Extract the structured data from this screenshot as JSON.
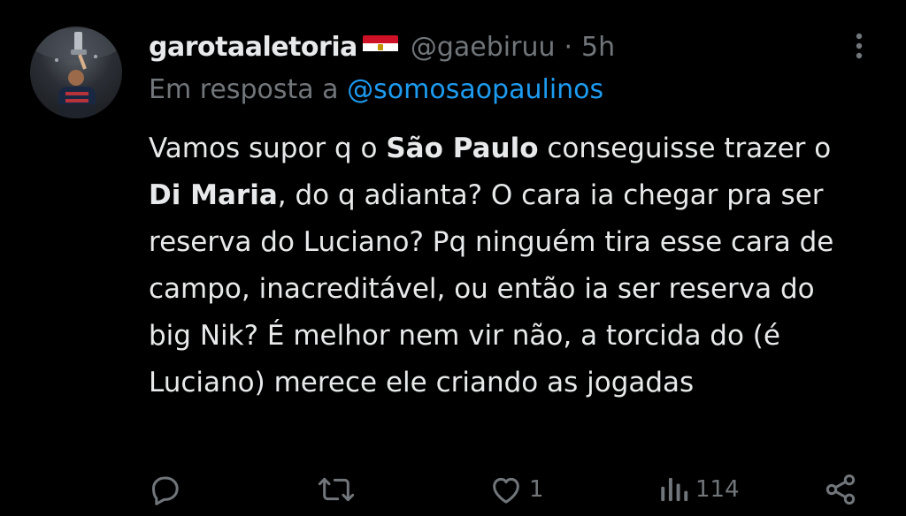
{
  "tweet": {
    "display_name": "garotaaletoria",
    "flag": "egypt-flag",
    "handle": "@gaebiruu",
    "separator": "·",
    "time": "5h",
    "reply_prefix": "Em resposta a",
    "reply_to": "@somosaopaulinos",
    "text_segments": {
      "s1": "Vamos supor q o ",
      "b1": "São Paulo",
      "s2": " conseguisse trazer o ",
      "b2": "Di Maria",
      "s3": ", do q adianta? O cara ia chegar pra ser reserva do Luciano? Pq ninguém tira esse cara de campo, inacreditável, ou então ia ser reserva do big Nik? É melhor nem vir não, a torcida do (é Luciano) merece ele criando as jogadas"
    }
  },
  "actions": {
    "reply_count": "",
    "retweet_count": "",
    "like_count": "1",
    "view_count": "114"
  },
  "colors": {
    "background": "#000000",
    "text": "#e7e9ea",
    "secondary": "#71767b",
    "link": "#1d9bf0"
  }
}
